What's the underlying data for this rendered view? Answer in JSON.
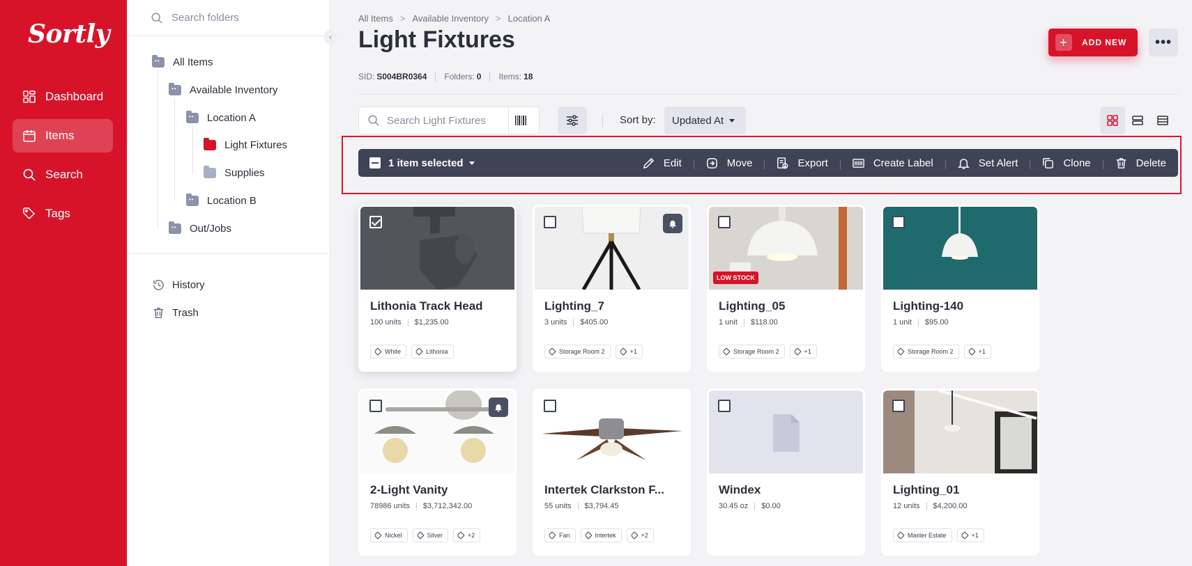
{
  "app": {
    "logo": "Sortly"
  },
  "nav": {
    "items": [
      {
        "label": "Dashboard",
        "icon": "dashboard-icon",
        "active": false
      },
      {
        "label": "Items",
        "icon": "items-icon",
        "active": true
      },
      {
        "label": "Search",
        "icon": "search-icon",
        "active": false
      },
      {
        "label": "Tags",
        "icon": "tags-icon",
        "active": false
      }
    ]
  },
  "folders": {
    "search_placeholder": "Search folders",
    "tree": [
      {
        "label": "All Items"
      },
      {
        "label": "Available Inventory"
      },
      {
        "label": "Location A"
      },
      {
        "label": "Light Fixtures"
      },
      {
        "label": "Supplies"
      },
      {
        "label": "Location B"
      },
      {
        "label": "Out/Jobs"
      }
    ],
    "links": [
      {
        "label": "History",
        "icon": "history-icon"
      },
      {
        "label": "Trash",
        "icon": "trash-icon"
      }
    ]
  },
  "header": {
    "breadcrumb": [
      "All Items",
      "Available Inventory",
      "Location A"
    ],
    "title": "Light Fixtures",
    "sid_label": "SID:",
    "sid": "S004BR0364",
    "folders_label": "Folders:",
    "folders_count": "0",
    "items_label": "Items:",
    "items_count": "18",
    "add_new": "ADD NEW",
    "more": "•••"
  },
  "toolbar": {
    "search_placeholder": "Search Light Fixtures",
    "sort_label": "Sort by:",
    "sort_value": "Updated At"
  },
  "bulk": {
    "selected": "1 item selected",
    "actions": [
      {
        "label": "Edit",
        "icon": "pencil-icon"
      },
      {
        "label": "Move",
        "icon": "move-icon"
      },
      {
        "label": "Export",
        "icon": "export-icon"
      },
      {
        "label": "Create Label",
        "icon": "barcode-icon"
      },
      {
        "label": "Set Alert",
        "icon": "bell-icon"
      },
      {
        "label": "Clone",
        "icon": "clone-icon"
      },
      {
        "label": "Delete",
        "icon": "delete-icon"
      }
    ]
  },
  "items": [
    {
      "name": "Lithonia Track Head",
      "qty": "100 units",
      "price": "$1,235.00",
      "tags": [
        "White",
        "Lithonia"
      ],
      "checked": true
    },
    {
      "name": "Lighting_7",
      "qty": "3 units",
      "price": "$405.00",
      "tags": [
        "Storage Room 2",
        "+1"
      ],
      "alert": true
    },
    {
      "name": "Lighting_05",
      "qty": "1 unit",
      "price": "$118.00",
      "tags": [
        "Storage Room 2",
        "+1"
      ],
      "badge": "LOW STOCK"
    },
    {
      "name": "Lighting-140",
      "qty": "1 unit",
      "price": "$95.00",
      "tags": [
        "Storage Room 2",
        "+1"
      ]
    },
    {
      "name": "2-Light Vanity",
      "qty": "78986 units",
      "price": "$3,712,342.00",
      "tags": [
        "Nickel",
        "Silver",
        "+2"
      ],
      "alert": true
    },
    {
      "name": "Intertek Clarkston F...",
      "qty": "55 units",
      "price": "$3,794.45",
      "tags": [
        "Fan",
        "Intertek",
        "+2"
      ]
    },
    {
      "name": "Windex",
      "qty": "30.45 oz",
      "price": "$0.00",
      "tags": []
    },
    {
      "name": "Lighting_01",
      "qty": "12 units",
      "price": "$4,200.00",
      "tags": [
        "Master Estate",
        "+1"
      ]
    }
  ],
  "colors": {
    "brand": "#d7132a",
    "bulk_bar": "#3f4356"
  }
}
